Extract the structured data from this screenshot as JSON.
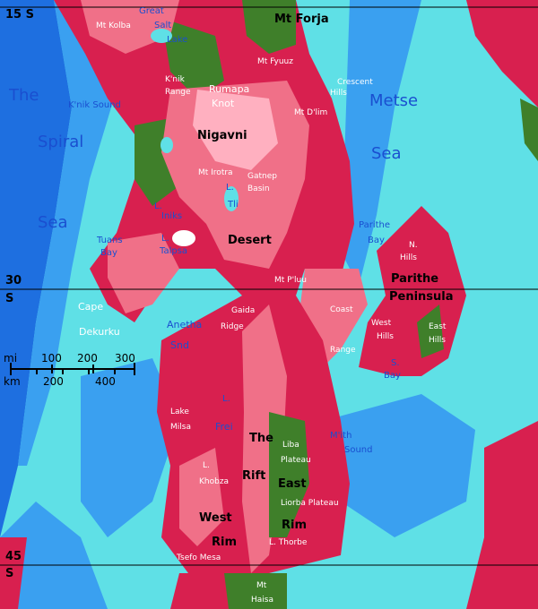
{
  "colors": {
    "deep_ocean": "#1e6fe0",
    "ocean": "#3aa0f0",
    "shelf": "#5fe0e6",
    "lowland": "#3f7f2a",
    "highland": "#d8204f",
    "plateau": "#f07088",
    "peak": "#ffb0c0"
  },
  "latitudes": {
    "top": "15 S",
    "mid_num": "30",
    "mid_s": "S",
    "bottom_num": "45",
    "bottom_s": "S"
  },
  "scale": {
    "mi_label": "mi",
    "mi_ticks": [
      "100",
      "200",
      "300"
    ],
    "km_label": "km",
    "km_ticks": [
      "200",
      "400"
    ]
  },
  "labels": {
    "spiral_sea": [
      "The",
      "Spiral",
      "Sea"
    ],
    "metse_sea": [
      "Metse",
      "Sea"
    ],
    "mt_forja": "Mt Forja",
    "mt_kolba": "Mt Kolba",
    "great_salt_lake": [
      "Great",
      "Salt",
      "Lake"
    ],
    "mt_fyuuz": "Mt Fyuuz",
    "crescent_hills": [
      "Crescent",
      "Hills"
    ],
    "knik_range": [
      "K'nik",
      "Range"
    ],
    "rumapa_knot": [
      "Rumapa",
      "Knot"
    ],
    "knik_sound": "K'nik Sound",
    "mt_dlim": "Mt D'lim",
    "nigavni": "Nigavni",
    "mt_irotra": "Mt Irotra",
    "gatnep_basin": [
      "Gatnep",
      "Basin"
    ],
    "l_iniks": [
      "L.",
      "Iniks"
    ],
    "l_tli": [
      "L.",
      "Tli"
    ],
    "tuans_bay": [
      "Tuans",
      "Bay"
    ],
    "l_talpsa": [
      "L.",
      "Talpsa"
    ],
    "desert": "Desert",
    "parithe_bay": [
      "Parithe",
      "Bay"
    ],
    "n_hills": [
      "N.",
      "Hills"
    ],
    "parithe_peninsula": [
      "Parithe",
      "Peninsula"
    ],
    "mt_pluu": "Mt P'luu",
    "cape_dekurku": [
      "Cape",
      "Dekurku"
    ],
    "anetha_snd": [
      "Anetha",
      "Snd"
    ],
    "gaida_ridge": [
      "Gaida",
      "Ridge"
    ],
    "coast_range": [
      "Coast",
      "Range"
    ],
    "west_hills": [
      "West",
      "Hills"
    ],
    "east_hills": [
      "East",
      "Hills"
    ],
    "s_bay": [
      "S.",
      "Bay"
    ],
    "l_frei": [
      "L.",
      "Frei"
    ],
    "lake_milsa": [
      "Lake",
      "Milsa"
    ],
    "the_rift": [
      "The",
      "Rift"
    ],
    "liba_plateau": [
      "Liba",
      "Plateau"
    ],
    "mith_sound": [
      "M'ith",
      "Sound"
    ],
    "l_khobza": [
      "L.",
      "Khobza"
    ],
    "east_rim": [
      "East",
      "Rim"
    ],
    "liorba_plateau": "Liorba Plateau",
    "west_rim": [
      "West",
      "Rim"
    ],
    "l_thorbe": "L. Thorbe",
    "tsefo_mesa": "Tsefo Mesa",
    "mt_haisa": [
      "Mt",
      "Haisa"
    ]
  }
}
